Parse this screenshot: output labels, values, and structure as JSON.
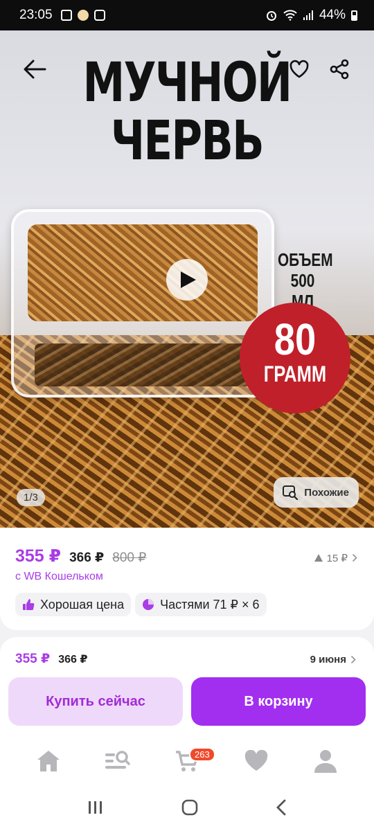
{
  "status_bar": {
    "time": "23:05",
    "battery": "44%"
  },
  "hero": {
    "title_line1": "МУЧНОЙ",
    "title_line2": "ЧЕРВЬ",
    "volume_line1": "ОБЪЕМ",
    "volume_line2": "500 МЛ",
    "weight_value": "80",
    "weight_unit": "ГРАММ",
    "image_counter": "1/3",
    "similar_label": "Похожие"
  },
  "price": {
    "main": "355 ₽",
    "without_wallet": "366 ₽",
    "old": "800 ₽",
    "wallet_note": "с WB Кошельком",
    "rating_count": "15 ₽",
    "chip_good_price": "Хорошая цена",
    "chip_installments": "Частями 71 ₽ × 6"
  },
  "buy_bar": {
    "price": "355 ₽",
    "price_second": "366 ₽",
    "delivery_date": "9 июня",
    "buy_now": "Купить сейчас",
    "add_to_cart": "В корзину"
  },
  "bottom_nav": {
    "cart_badge": "263"
  },
  "colors": {
    "accent": "#a22ef0",
    "accent_light": "#efd9fb",
    "price_purple": "#a93de6",
    "badge_red": "#c0202a",
    "cart_badge": "#f04a2b"
  },
  "icons": [
    "back-arrow-icon",
    "heart-icon",
    "share-icon",
    "play-icon",
    "image-search-icon",
    "thumbs-up-icon",
    "pie-chart-icon",
    "home-icon",
    "catalog-search-icon",
    "cart-icon",
    "heart-nav-icon",
    "profile-icon",
    "recents-icon",
    "home-circle-icon",
    "back-chevron-icon"
  ]
}
